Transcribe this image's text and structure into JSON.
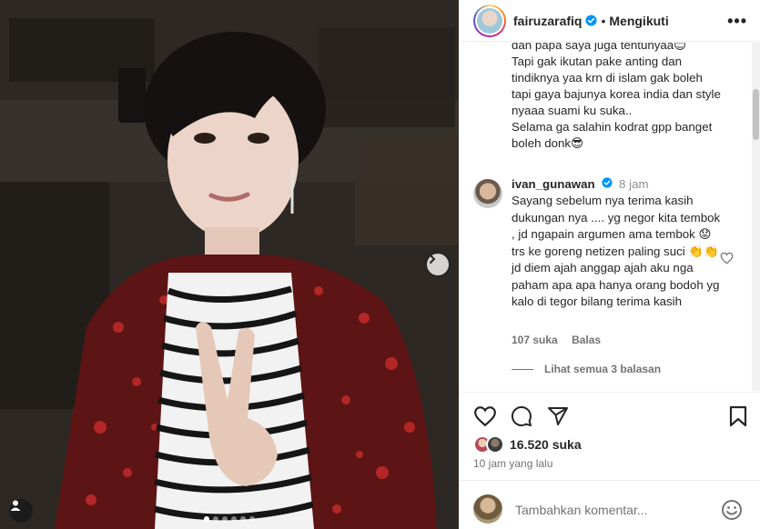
{
  "post": {
    "username": "fairuzarafiq",
    "separator": "•",
    "follow_label": "Mengikuti",
    "more_label": "•••"
  },
  "caption_lines": [
    "dan papa saya juga tentunyaa😊",
    "Tapi gak ikutan pake anting dan",
    "tindiknya yaa krn di islam gak boleh",
    "tapi gaya bajunya korea india dan style",
    "nyaaa suami ku suka..",
    "Selama ga salahin kodrat gpp banget",
    "boleh donk😎"
  ],
  "comment": {
    "username": "ivan_gunawan",
    "time": "8 jam",
    "text": "Sayang sebelum nya terima kasih dukungan nya .... yg negor kita tembok , jd ngapain argumen ama tembok 😟 trs ke goreng netizen paling suci 👏👏 jd diem ajah anggap ajah aku nga paham apa apa hanya orang bodoh yg kalo di tegor bilang terima kasih",
    "likes": "107 suka",
    "reply_label": "Balas",
    "view_replies": "Lihat semua 3 balasan"
  },
  "footer": {
    "likes_count": "16.520 suka",
    "post_time": "10 jam yang lalu",
    "add_comment_placeholder": "Tambahkan komentar..."
  },
  "carousel": {
    "total": 6,
    "active_index": 0
  },
  "icons": {
    "like": "heart-icon",
    "comment": "comment-icon",
    "share": "share-icon",
    "save": "bookmark-icon",
    "next": "chevron-right-icon",
    "emoji": "emoji-icon",
    "verified": "verified-badge-icon",
    "user_tag": "user-tag-icon"
  },
  "colors": {
    "verified": "#0095f6",
    "text": "#262626",
    "muted": "#737373"
  }
}
